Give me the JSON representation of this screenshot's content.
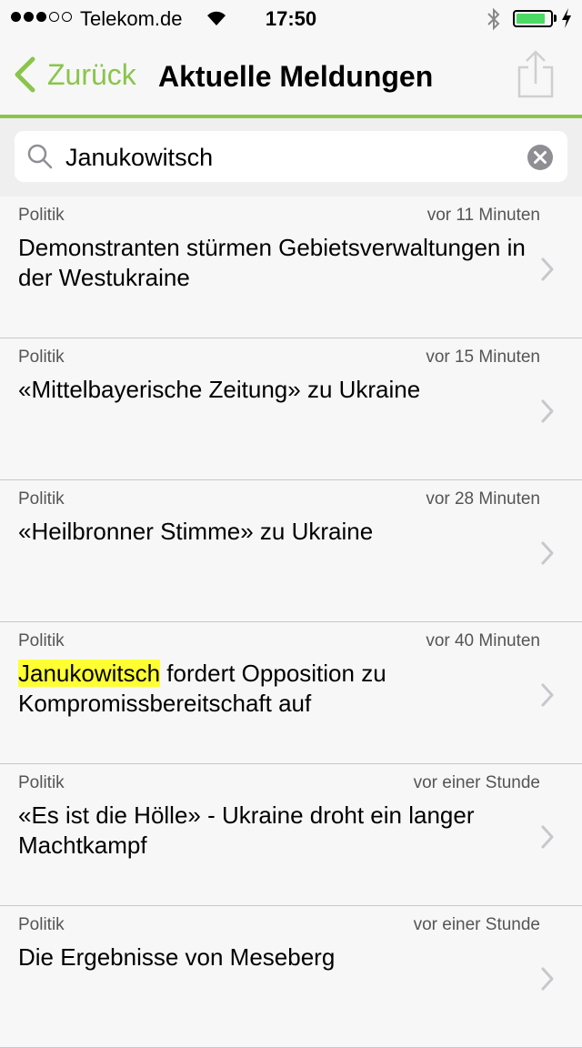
{
  "status_bar": {
    "signal_full": 3,
    "signal_empty": 2,
    "carrier": "Telekom.de",
    "time": "17:50",
    "battery_fraction": 0.85
  },
  "nav": {
    "back_label": "Zurück",
    "title": "Aktuelle Meldungen"
  },
  "search": {
    "value": "Janukowitsch",
    "placeholder": ""
  },
  "colors": {
    "accent": "#8ac54b",
    "highlight": "#ffff33",
    "battery": "#4cd964"
  },
  "news": [
    {
      "category": "Politik",
      "time": "vor 11 Minuten",
      "title_before": "Demonstranten stürmen Gebietsverwaltungen in der Westukraine",
      "title_highlight": "",
      "title_after": ""
    },
    {
      "category": "Politik",
      "time": "vor 15 Minuten",
      "title_before": "«Mittelbayerische Zeitung»  zu Ukraine",
      "title_highlight": "",
      "title_after": ""
    },
    {
      "category": "Politik",
      "time": "vor 28 Minuten",
      "title_before": "«Heilbronner Stimme» zu Ukraine",
      "title_highlight": "",
      "title_after": ""
    },
    {
      "category": "Politik",
      "time": "vor 40 Minuten",
      "title_before": "",
      "title_highlight": "Janukowitsch",
      "title_after": " fordert Opposition zu Kompromissbereitschaft auf"
    },
    {
      "category": "Politik",
      "time": "vor einer Stunde",
      "title_before": "«Es ist die Hölle» - Ukraine droht ein langer Machtkampf",
      "title_highlight": "",
      "title_after": ""
    },
    {
      "category": "Politik",
      "time": "vor einer Stunde",
      "title_before": "Die Ergebnisse von Meseberg",
      "title_highlight": "",
      "title_after": ""
    }
  ]
}
